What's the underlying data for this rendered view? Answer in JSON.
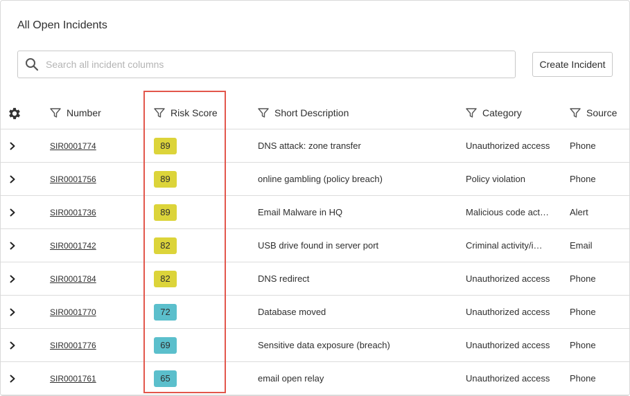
{
  "page": {
    "title": "All Open Incidents"
  },
  "search": {
    "placeholder": "Search all incident columns",
    "value": ""
  },
  "toolbar": {
    "create_label": "Create Incident"
  },
  "colors": {
    "badge_high": "#dcd43a",
    "badge_medium": "#5bbfcc",
    "highlight_border": "#e2564b"
  },
  "columns": [
    {
      "label": "Number"
    },
    {
      "label": "Risk Score"
    },
    {
      "label": "Short Description"
    },
    {
      "label": "Category"
    },
    {
      "label": "Source"
    }
  ],
  "rows": [
    {
      "number": "SIR0001774",
      "risk": "89",
      "level": "high",
      "description": "DNS attack: zone transfer",
      "category": "Unauthorized access",
      "source": "Phone"
    },
    {
      "number": "SIR0001756",
      "risk": "89",
      "level": "high",
      "description": "online gambling (policy breach)",
      "category": "Policy violation",
      "source": "Phone"
    },
    {
      "number": "SIR0001736",
      "risk": "89",
      "level": "high",
      "description": "Email Malware in HQ",
      "category": "Malicious code act…",
      "source": "Alert"
    },
    {
      "number": "SIR0001742",
      "risk": "82",
      "level": "high",
      "description": "USB drive found in server port",
      "category": "Criminal activity/i…",
      "source": "Email"
    },
    {
      "number": "SIR0001784",
      "risk": "82",
      "level": "high",
      "description": "DNS redirect",
      "category": "Unauthorized access",
      "source": "Phone"
    },
    {
      "number": "SIR0001770",
      "risk": "72",
      "level": "medium",
      "description": "Database moved",
      "category": "Unauthorized access",
      "source": "Phone"
    },
    {
      "number": "SIR0001776",
      "risk": "69",
      "level": "medium",
      "description": "Sensitive data exposure (breach)",
      "category": "Unauthorized access",
      "source": "Phone"
    },
    {
      "number": "SIR0001761",
      "risk": "65",
      "level": "medium",
      "description": "email open relay",
      "category": "Unauthorized access",
      "source": "Phone"
    }
  ]
}
